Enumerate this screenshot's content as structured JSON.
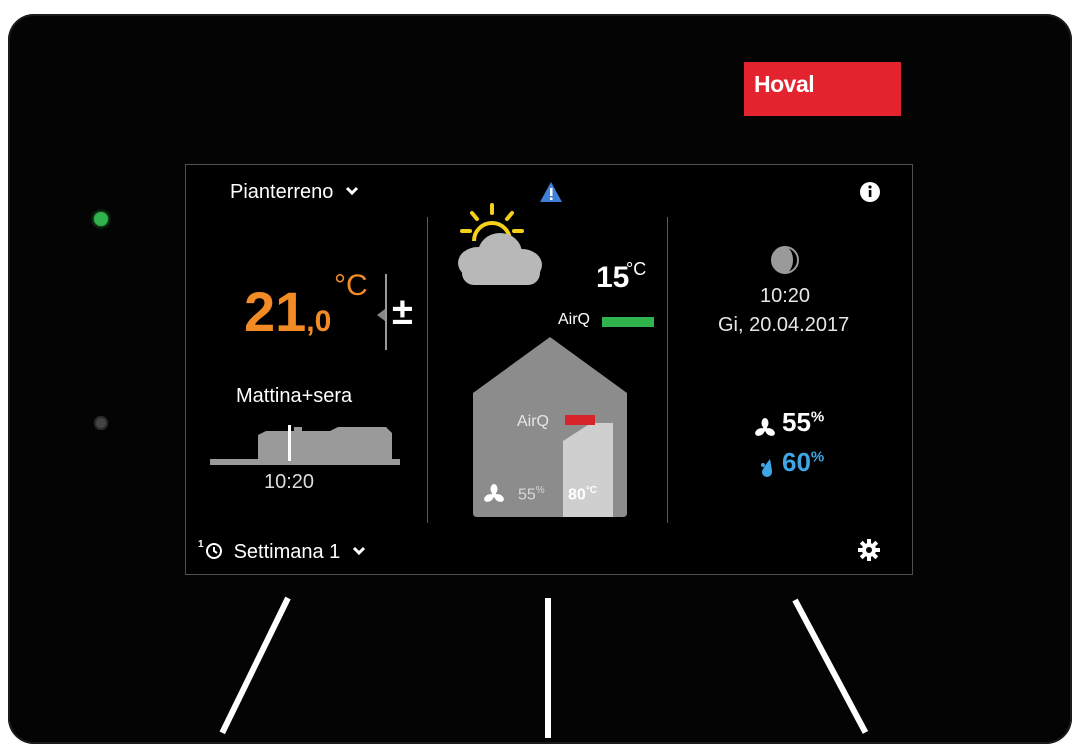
{
  "brand": "Hoval",
  "left": {
    "zone_label": "Pianterreno",
    "temp_main": "21",
    "temp_decimal": ",0",
    "temp_unit": "°C",
    "adjust_symbol": "±",
    "program_name": "Mattina+sera",
    "schedule_time": "10:20",
    "week_label": "Settimana 1"
  },
  "middle": {
    "outdoor_temp": "15",
    "outdoor_unit": "°C",
    "airq_outdoor_label": "AirQ",
    "airq_indoor_label": "AirQ",
    "fan_value": "55",
    "fan_unit": "%",
    "water_temp": "80",
    "water_unit": "°C"
  },
  "right": {
    "time": "10:20",
    "date": "Gi, 20.04.2017",
    "fan_value": "55",
    "fan_unit": "%",
    "humidity_value": "60",
    "humidity_unit": "%"
  },
  "colors": {
    "temp_orange": "#f28a25",
    "airq_good": "#2fb34a",
    "airq_bad": "#d9232b",
    "humidity_blue": "#3fa6e6",
    "brand_red": "#e3232d"
  },
  "icons": [
    "chevron-down-icon",
    "warning-icon",
    "info-icon",
    "sun-cloud-icon",
    "moon-icon",
    "fan-icon",
    "water-drop-icon",
    "gear-icon",
    "clock-icon",
    "house-icon"
  ]
}
